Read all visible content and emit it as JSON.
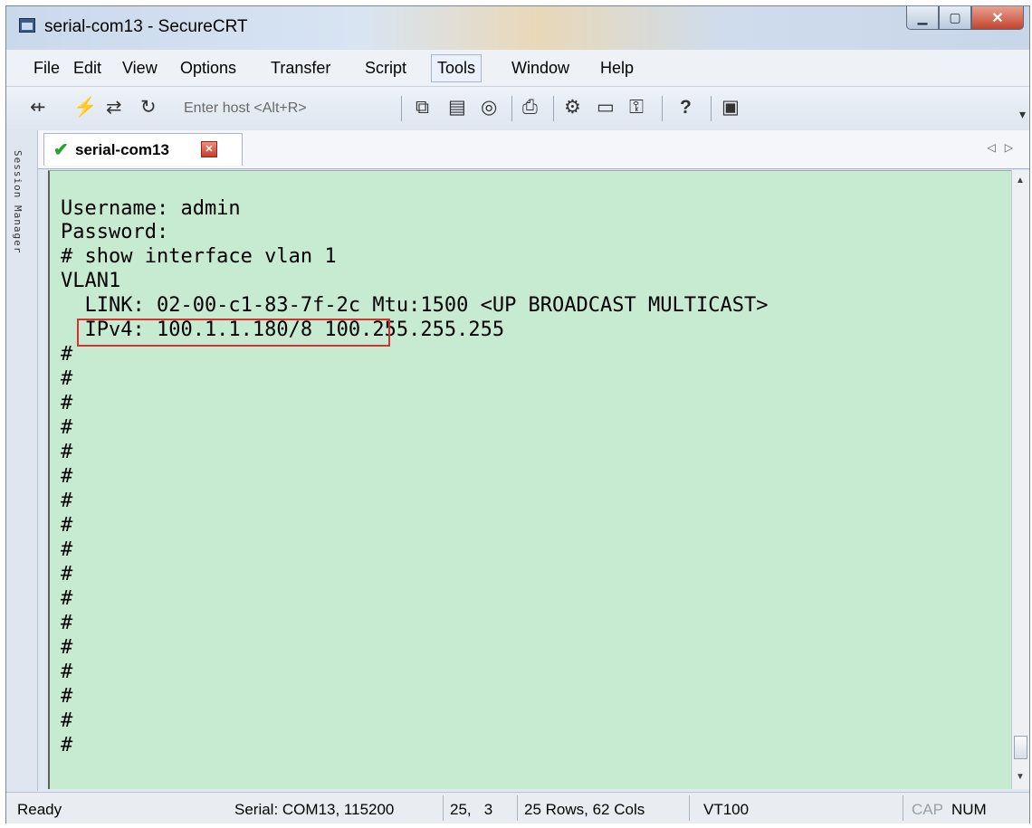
{
  "window": {
    "title": "serial-com13 - SecureCRT",
    "controls": [
      "minimize-icon",
      "maximize-icon",
      "close-icon"
    ]
  },
  "menu": {
    "items": [
      "File",
      "Edit",
      "View",
      "Options",
      "Transfer",
      "Script",
      "Tools",
      "Window",
      "Help"
    ]
  },
  "toolbar": {
    "enter_host": "Enter host <Alt+R>",
    "icons": [
      "connect-icon",
      "quick-connect-icon",
      "connect-tab-icon",
      "reconnect-icon",
      "copy-icon",
      "paste-icon",
      "find-icon",
      "print-icon",
      "settings-icon",
      "key-map-icon",
      "sftp-key-icon",
      "help-icon",
      "about-icon"
    ]
  },
  "side": {
    "label": "Session Manager"
  },
  "tab": {
    "label": "serial-com13"
  },
  "terminal": {
    "lines": [
      "Username: admin",
      "Password:",
      "# show interface vlan 1",
      "VLAN1",
      "  LINK: 02-00-c1-83-7f-2c Mtu:1500 <UP BROADCAST MULTICAST>",
      "  IPv4: 100.1.1.180/8 100.255.255.255",
      "#",
      "#",
      "#",
      "#",
      "#",
      "#",
      "#",
      "#",
      "#",
      "#",
      "#",
      "#",
      "#",
      "#",
      "#",
      "#",
      "#"
    ],
    "background": "#c7ebd0",
    "highlight_color": "#d8322e"
  },
  "status": {
    "ready": "Ready",
    "serial": "Serial: COM13, 115200",
    "cursor": "25,   3",
    "size": "25 Rows, 62 Cols",
    "emulation": "VT100",
    "cap": "CAP",
    "num": "NUM"
  }
}
